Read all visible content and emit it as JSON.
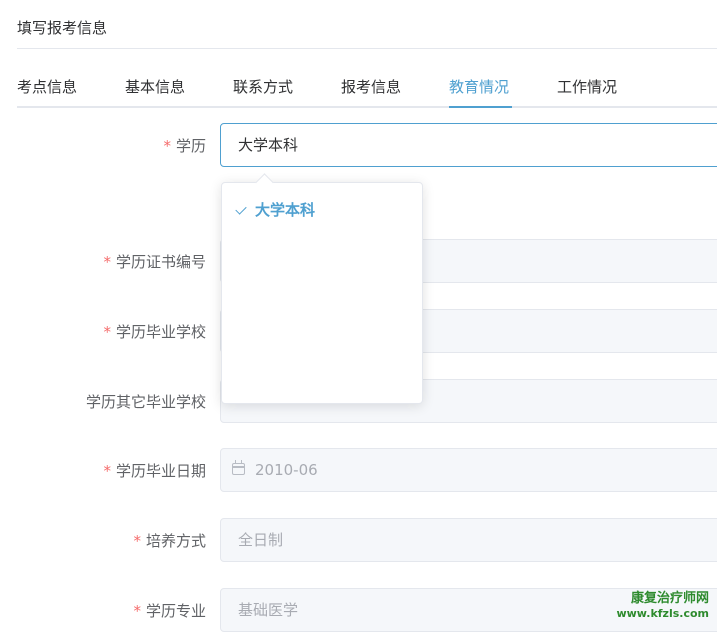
{
  "page": {
    "title": "填写报考信息"
  },
  "tabs": [
    {
      "label": "考点信息",
      "active": false
    },
    {
      "label": "基本信息",
      "active": false
    },
    {
      "label": "联系方式",
      "active": false
    },
    {
      "label": "报考信息",
      "active": false
    },
    {
      "label": "教育情况",
      "active": true
    },
    {
      "label": "工作情况",
      "active": false
    }
  ],
  "form": {
    "required_mark": "*",
    "degree": {
      "label": "学历",
      "value": "大学本科",
      "required": true
    },
    "cert_no": {
      "label": "学历证书编号",
      "value": "",
      "required": true
    },
    "school": {
      "label": "学历毕业学校",
      "value": "",
      "required": true
    },
    "other_school": {
      "label": "学历其它毕业学校",
      "value": "",
      "required": false
    },
    "grad_date": {
      "label": "学历毕业日期",
      "value": "2010-06",
      "required": true,
      "icon": "calendar-icon"
    },
    "study_mode": {
      "label": "培养方式",
      "value": "全日制",
      "required": true
    },
    "major": {
      "label": "学历专业",
      "value": "基础医学",
      "required": true
    }
  },
  "dropdown": {
    "options": [
      {
        "label": "大学本科",
        "selected": true,
        "icon": "check-icon"
      }
    ]
  },
  "watermark": {
    "line1": "康复治疗师网",
    "line2": "www.kfzls.com"
  },
  "colors": {
    "accent": "#4fa0d0",
    "required": "#f56c6c",
    "watermark": "#2e8b2e"
  }
}
